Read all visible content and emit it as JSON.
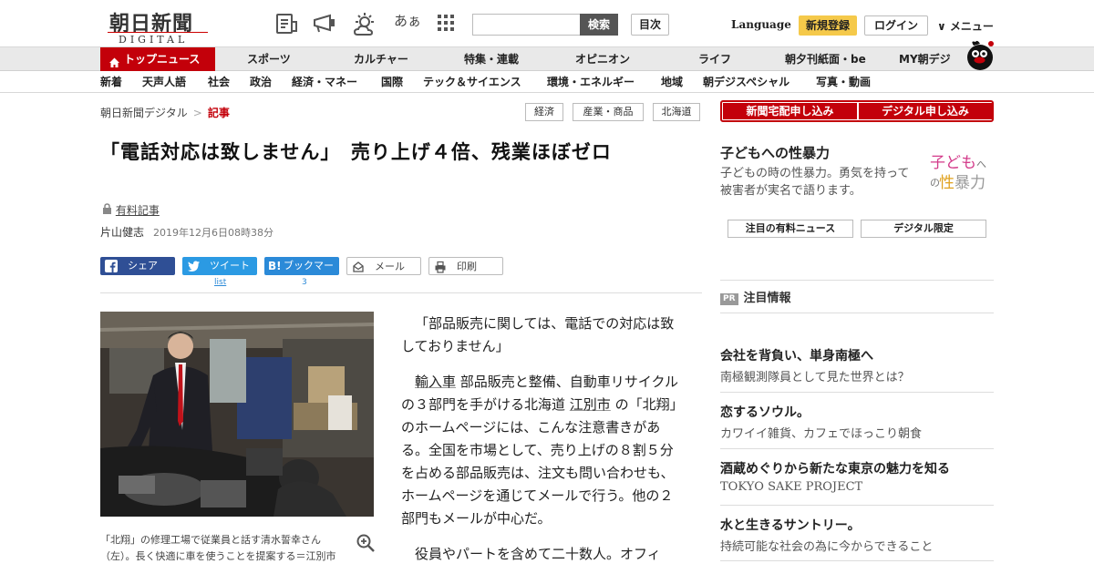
{
  "header": {
    "logo_kanji": "朝日新聞",
    "logo_digital": "DIGITAL",
    "kana_icon": "あぁ",
    "search_placeholder": "",
    "search_label": "検索",
    "toc_label": "目次",
    "language_label": "Language",
    "register_label": "新規登録",
    "login_label": "ログイン",
    "menu_label": "∨ メニュー",
    "icons": [
      "newspaper-icon",
      "megaphone-icon",
      "weather-icon",
      "text-size-icon",
      "grid-icon"
    ]
  },
  "nav1": {
    "top_label": "トップニュース",
    "items": [
      "スポーツ",
      "カルチャー",
      "特集・連載",
      "オピニオン",
      "ライフ",
      "朝夕刊紙面・be",
      "MY朝デジ"
    ]
  },
  "nav2": {
    "items": [
      "新着",
      "天声人語",
      "社会",
      "政治",
      "経済・マネー",
      "国際",
      "テック＆サイエンス",
      "環境・エネルギー",
      "地域",
      "朝デジスペシャル",
      "写真・動画"
    ]
  },
  "breadcrumb": {
    "home": "朝日新聞デジタル",
    "sep": ">",
    "current": "記事"
  },
  "tags": [
    "経済",
    "産業・商品",
    "北海道"
  ],
  "article": {
    "title": "「電話対応は致しません」　売り上げ４倍、残業ほぼゼロ",
    "paid_label": "有料記事",
    "author": "片山健志",
    "date": "2019年12月6日08時38分",
    "share": {
      "facebook": "シェア",
      "twitter": "ツイート",
      "twitter_count": "list",
      "hatena": "ブックマーク",
      "hatena_prefix": "B!",
      "hatena_count": "3",
      "mail": "メール",
      "print": "印刷"
    },
    "caption": "「北翔」の修理工場で従業員と話す清水誓幸さん（左）。長く快適に車を使うことを提案する＝江別市",
    "paragraphs": {
      "p1": "「部品販売に関しては、電話での対応は致しておりません」",
      "p2a": "輸入車",
      "p2b": "部品販売と整備、自動車リサイクルの３部門を手がける北海道",
      "p2c": "江別市",
      "p2d": "の「北翔」のホームページには、こんな注意書きがある。全国を市場として、売り上げの８割５分を占める部品販売は、注文も問い合わせも、ホームページを通じてメールで行う。他の２部門もメールが中心だ。",
      "p3": "役員やパートを含めて二十数人。オフィ"
    }
  },
  "sidebar": {
    "subscribe_newspaper": "新聞宅配申し込み",
    "subscribe_digital": "デジタル申し込み",
    "ad_title": "子どもへの性暴力",
    "ad_desc": "子どもの時の性暴力。勇気を持って被害者が実名で語ります。",
    "ad_logo_line1": "子ども",
    "ad_logo_line1b": "への",
    "ad_logo_line2a": "性",
    "ad_logo_line2b": "暴力",
    "pill_paid_news": "注目の有料ニュース",
    "pill_digital_only": "デジタル限定",
    "pr_badge": "PR",
    "pr_heading": "注目情報",
    "pr_items": [
      {
        "title": "会社を背負い、単身南極へ",
        "desc": "南極観測隊員として見た世界とは？"
      },
      {
        "title": "恋するソウル。",
        "desc": "カワイイ雑貨、カフェでほっこり朝食"
      },
      {
        "title": "酒蔵めぐりから新たな東京の魅力を知る",
        "desc": "TOKYO SAKE PROJECT"
      },
      {
        "title": "水と生きるサントリー。",
        "desc": "持続可能な社会の為に今からできること"
      }
    ]
  },
  "colors": {
    "brand_red": "#c3000a",
    "register_yellow": "#f5c94a",
    "facebook_blue": "#2f4f95",
    "twitter_blue": "#2b9ae3",
    "hatena_blue": "#2b8ad8"
  }
}
